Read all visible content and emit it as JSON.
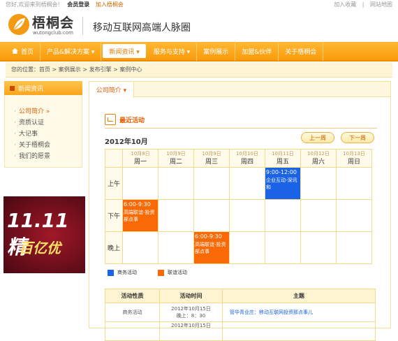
{
  "topbar": {
    "welcome": "您好,欢迎来到梧桐会!",
    "login": "会员登录",
    "join": "加入梧桐会",
    "favorite": "加入收藏",
    "sitemap": "网站地图",
    "divider": "|"
  },
  "header": {
    "logo_text": "梧桐会",
    "logo_sub": "wutongclub.com",
    "slogan": "移动互联网高端人脉圈"
  },
  "nav": [
    {
      "label": "首页"
    },
    {
      "label": "产品&解决方案 ▾"
    },
    {
      "label": "新闻资讯 ▾"
    },
    {
      "label": "服务与支持 ▾"
    },
    {
      "label": "案例展示"
    },
    {
      "label": "加盟&伙伴"
    },
    {
      "label": "关于梧桐会"
    }
  ],
  "breadcrumb": "您的位置：首页 > 案例展示 > 发布引擎 > 案例中心",
  "sidebar": {
    "title": "新闻资讯",
    "items": [
      {
        "label": "公司简介 »"
      },
      {
        "label": "资质认证"
      },
      {
        "label": "大记事"
      },
      {
        "label": "关于梧桐会"
      },
      {
        "label": "我们的愿景"
      }
    ]
  },
  "banner": {
    "big": "11.11精",
    "sub": "百亿优"
  },
  "main": {
    "tab": "公司简介 ▾",
    "section_title": "最近活动",
    "month": "2012年10月",
    "prev_label": "上一周",
    "next_label": "下一周"
  },
  "calendar": {
    "days": [
      {
        "date": "10月8日",
        "week": "周一"
      },
      {
        "date": "10月9日",
        "week": "周二"
      },
      {
        "date": "10月9日",
        "week": "周三"
      },
      {
        "date": "10月10日",
        "week": "周四"
      },
      {
        "date": "10月11日",
        "week": "周五"
      },
      {
        "date": "10月12日",
        "week": "周六"
      },
      {
        "date": "10月13日",
        "week": "周日"
      }
    ],
    "rows": [
      "上午",
      "下午",
      "晚上"
    ],
    "events": [
      {
        "time": "9:00-12:00",
        "title": "企业互动-深讯和",
        "type": "blue"
      },
      {
        "time": "6:00-9:30",
        "title": "高端联谊-投资部点事",
        "type": "orange"
      },
      {
        "time": "6:00-9:30",
        "title": "高端联谊-投资部点事",
        "type": "orange"
      }
    ]
  },
  "legend": {
    "business": "商务活动",
    "social": "联谊活动",
    "colors": {
      "business": "#1a62e6",
      "social": "#f96a06"
    }
  },
  "list": {
    "headers": [
      "活动性质",
      "活动时间",
      "主题"
    ],
    "rows": [
      {
        "type": "商务活动",
        "date": "2012年10月15日",
        "time": "晚上：8：30",
        "topic": "管华青业庄：移动互联网投资那点事儿"
      }
    ],
    "partial_date": "2012年10月15日"
  }
}
